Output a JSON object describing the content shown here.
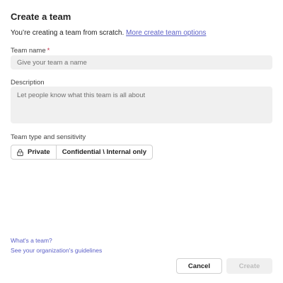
{
  "dialog": {
    "title": "Create a team",
    "intro_text": "You’re creating a team from scratch.",
    "intro_link": "More create team options"
  },
  "team_name": {
    "label": "Team name",
    "required_marker": "*",
    "placeholder": "Give your team a name",
    "value": ""
  },
  "description": {
    "label": "Description",
    "placeholder": "Let people know what this team is all about",
    "value": ""
  },
  "team_type": {
    "label": "Team type and sensitivity",
    "privacy": "Private",
    "privacy_icon": "lock-icon",
    "sensitivity": "Confidential \\ Internal only"
  },
  "footer": {
    "whats_a_team_link": "What's a team?",
    "guidelines_link": "See your organization's guidelines"
  },
  "buttons": {
    "cancel": "Cancel",
    "create": "Create"
  },
  "colors": {
    "link": "#5b5fc7",
    "required": "#c4314b",
    "input_bg": "#f0f0f0",
    "disabled_text": "#bdbdbd"
  }
}
